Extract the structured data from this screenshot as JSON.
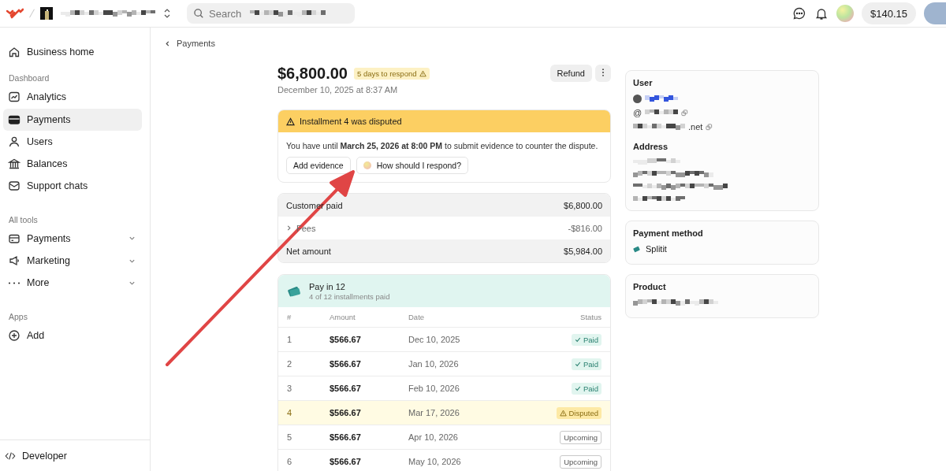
{
  "topbar": {
    "search": {
      "placeholder": "Search"
    },
    "balance": "$140.15"
  },
  "sidebar": {
    "home": {
      "label": "Business home",
      "selected": false
    },
    "sections": [
      {
        "title": "Dashboard",
        "items": [
          {
            "label": "Analytics",
            "selected": false,
            "expandable": false
          },
          {
            "label": "Payments",
            "selected": true,
            "expandable": false
          },
          {
            "label": "Users",
            "selected": false,
            "expandable": false
          },
          {
            "label": "Balances",
            "selected": false,
            "expandable": false
          },
          {
            "label": "Support chats",
            "selected": false,
            "expandable": false
          }
        ]
      },
      {
        "title": "All tools",
        "items": [
          {
            "label": "Payments",
            "selected": false,
            "expandable": true
          },
          {
            "label": "Marketing",
            "selected": false,
            "expandable": true
          },
          {
            "label": "More",
            "selected": false,
            "expandable": true
          }
        ]
      },
      {
        "title": "Apps",
        "items": [
          {
            "label": "Add",
            "selected": false,
            "expandable": false
          }
        ]
      }
    ],
    "footer": "Developer"
  },
  "breadcrumb": "Payments",
  "payment": {
    "amount": "$6,800.00",
    "badge": "5 days to respond",
    "date": "December 10, 2025 at 8:37 AM",
    "actions": [
      "Refund"
    ]
  },
  "dispute": {
    "title": "Installment 4 was disputed",
    "message": "You have until **March 25, 2026 at 8:00 PM** to submit evidence to counter the dispute.",
    "buttons": [
      "Add evidence",
      "How should I respond?"
    ]
  },
  "summary": [
    {
      "label": "Customer paid",
      "value": "$6,800.00",
      "kind": "total"
    },
    {
      "label": "Fees",
      "value": "-$816.00",
      "kind": "expandable"
    },
    {
      "label": "Net amount",
      "value": "$5,984.00",
      "kind": "total"
    }
  ],
  "plan": {
    "title": "Pay in 12",
    "subtitle": "4 of 12 installments paid",
    "columns": [
      "#",
      "Amount",
      "Date",
      "Status"
    ],
    "rows": [
      {
        "number": "1",
        "amount": "$566.67",
        "date": "Dec 10, 2025",
        "status": "Paid",
        "kind": "paid"
      },
      {
        "number": "2",
        "amount": "$566.67",
        "date": "Jan 10, 2026",
        "status": "Paid",
        "kind": "paid"
      },
      {
        "number": "3",
        "amount": "$566.67",
        "date": "Feb 10, 2026",
        "status": "Paid",
        "kind": "paid"
      },
      {
        "number": "4",
        "amount": "$566.67",
        "date": "Mar 17, 2026",
        "status": "Disputed",
        "kind": "disputed"
      },
      {
        "number": "5",
        "amount": "$566.67",
        "date": "Apr 10, 2026",
        "status": "Upcoming",
        "kind": "upcoming"
      },
      {
        "number": "6",
        "amount": "$566.67",
        "date": "May 10, 2026",
        "status": "Upcoming",
        "kind": "upcoming"
      }
    ]
  },
  "details": {
    "user": {
      "title": "User",
      "handle_prefix": "@",
      "email_suffix": ".net"
    },
    "address": {
      "title": "Address"
    },
    "payment_method": {
      "title": "Payment method",
      "value": "Splitit"
    },
    "product": {
      "title": "Product"
    }
  },
  "annotation": {
    "kind": "arrow"
  }
}
